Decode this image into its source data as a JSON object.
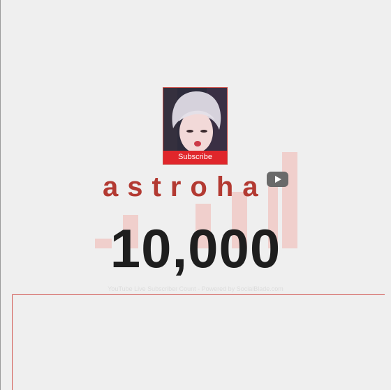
{
  "channel": {
    "name": "astroha",
    "subscribe_label": "Subscribe",
    "subscriber_count": "10,000"
  },
  "footer": {
    "text": "YouTube Live Subscriber Count - Powered by SocialBlade.com"
  },
  "icons": {
    "platform": "youtube-play-icon"
  },
  "colors": {
    "accent": "#b33a32",
    "subscribe_button": "#e0262b",
    "background": "#efefef",
    "count_text": "#1e1e1e"
  }
}
